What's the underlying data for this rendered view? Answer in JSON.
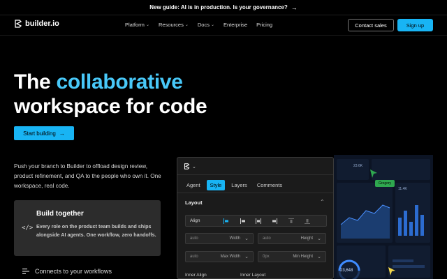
{
  "banner": {
    "text": "New guide: AI is in production. Is your governance?",
    "arrow": "→"
  },
  "nav": {
    "logo_text": "builder.io",
    "links": [
      {
        "label": "Platform",
        "dropdown": true
      },
      {
        "label": "Resources",
        "dropdown": true
      },
      {
        "label": "Docs",
        "dropdown": true
      },
      {
        "label": "Enterprise",
        "dropdown": false
      },
      {
        "label": "Pricing",
        "dropdown": false
      }
    ],
    "contact_label": "Contact sales",
    "signup_label": "Sign up"
  },
  "hero": {
    "title_prefix": "The ",
    "title_accent": "collaborative",
    "title_line2": "workspace for code",
    "cta_label": "Start building",
    "cta_arrow": "→",
    "description": "Push your branch to Builder to offload design review, product refinement, and QA to the people who own it. One workspace, real code."
  },
  "feature_card": {
    "icon": "code-icon",
    "title": "Build together",
    "body": "Every role on the product team builds and ships alongside AI agents. One workflow, zero handoffs."
  },
  "connect": {
    "icon": "list-icon",
    "label": "Connects to your workflows"
  },
  "editor_panel": {
    "tabs": [
      "Agent",
      "Style",
      "Layers",
      "Comments"
    ],
    "active_tab": "Style",
    "section_title": "Layout",
    "align_label": "Align",
    "fields": [
      {
        "value": "auto",
        "label": "Width"
      },
      {
        "value": "auto",
        "label": "Height"
      },
      {
        "value": "auto",
        "label": "Max Width"
      },
      {
        "value": "0px",
        "label": "Min Height"
      }
    ],
    "inner_align_label": "Inner Align",
    "inner_layout_label": "Inner Layout"
  },
  "dashboard": {
    "tag_label": "Gregory",
    "top_value": "23.6K",
    "side_value": "11.4K",
    "gauge_value": "23,648",
    "accent": "#2fa84f",
    "cursor_color": "#2fa84f",
    "cursor2_color": "#f2d64b"
  },
  "colors": {
    "accent": "#18b4f4",
    "accent_text": "#48c8f8",
    "background": "#000000"
  }
}
